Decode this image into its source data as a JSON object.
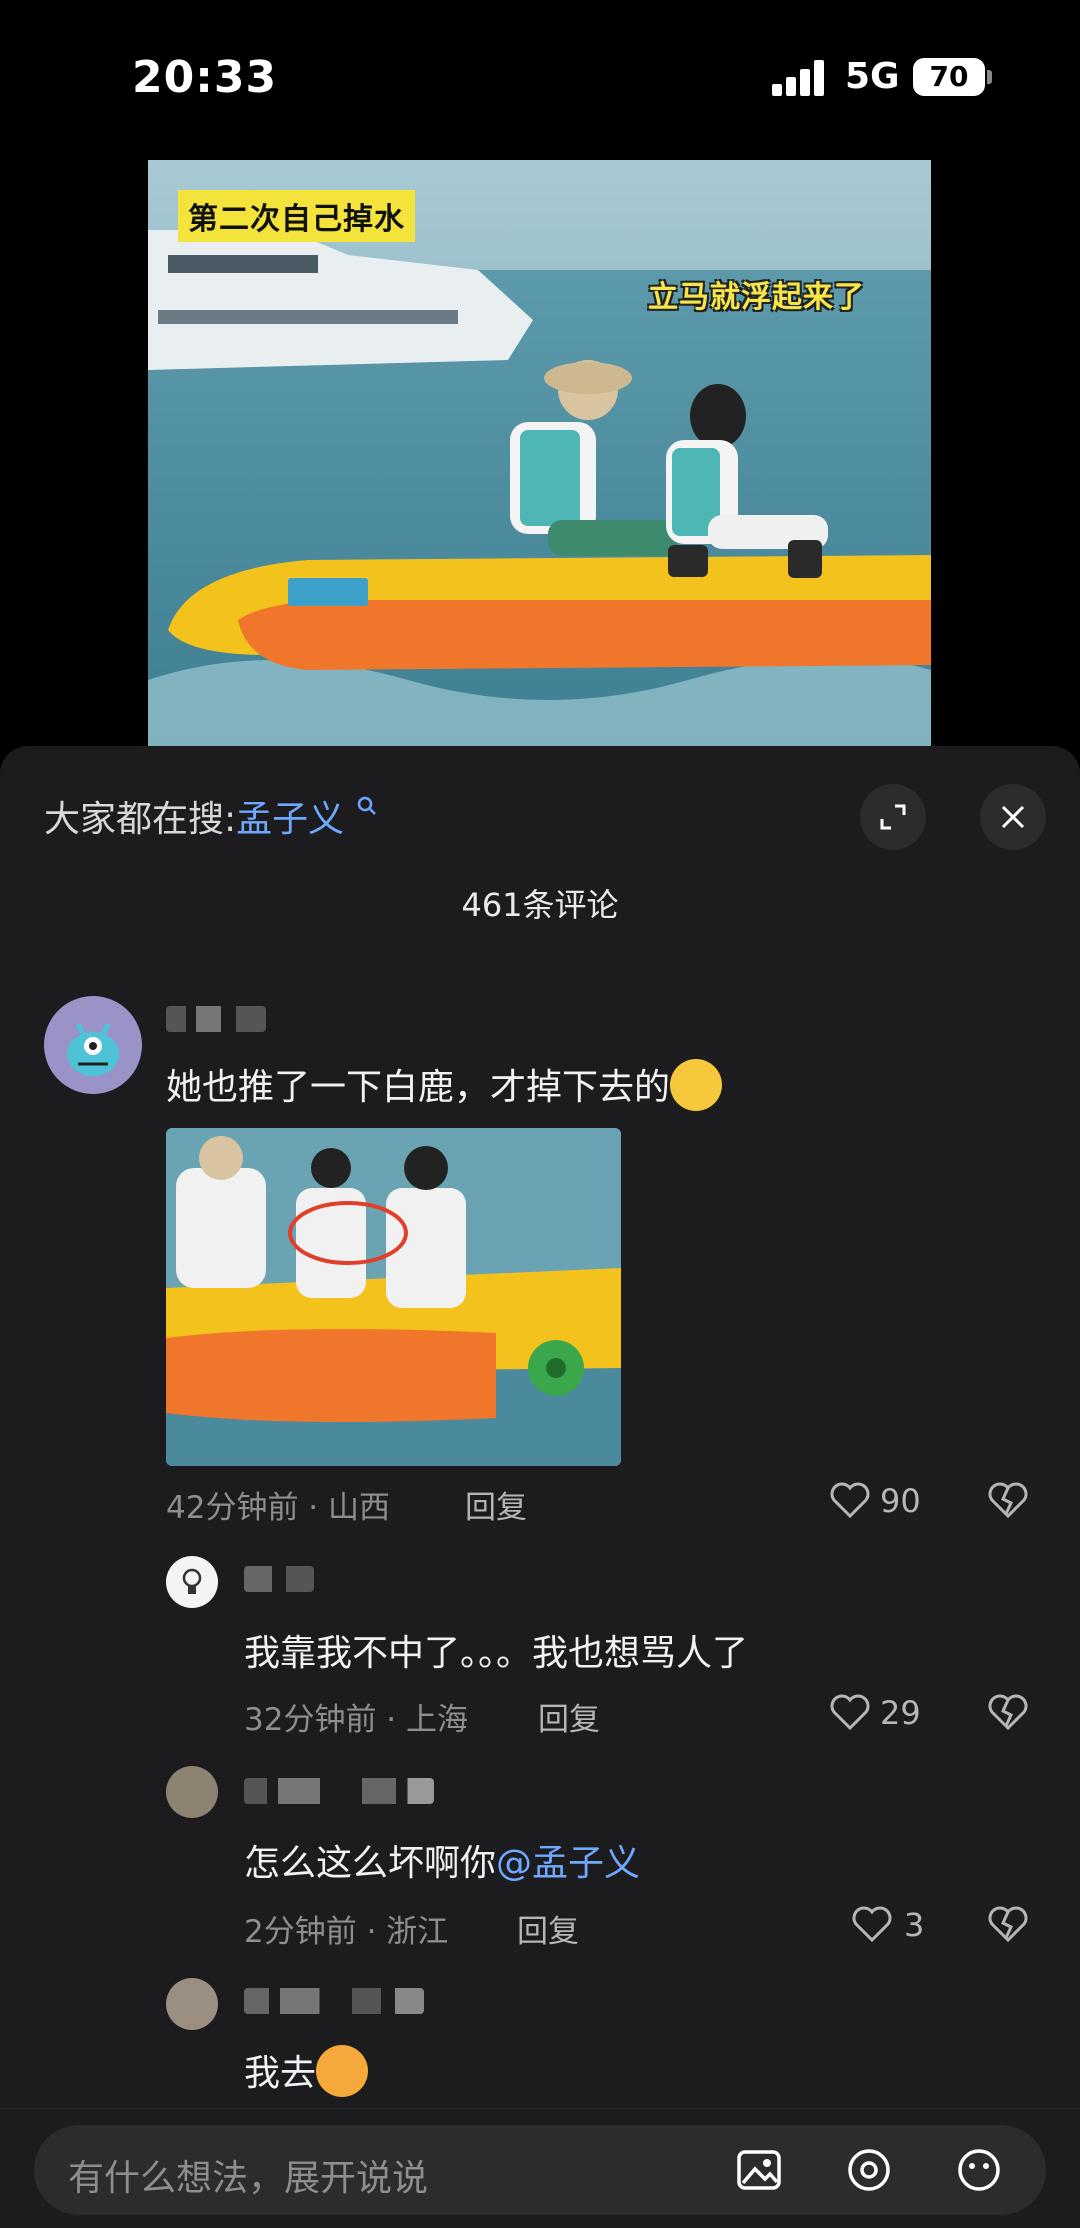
{
  "status_bar": {
    "time": "20:33",
    "network": "5G",
    "battery": "70"
  },
  "video": {
    "caption_top": "第二次自己掉水",
    "caption_right": "立马就浮起来了"
  },
  "panel": {
    "search_prefix": "大家都在搜:",
    "search_keyword": "孟子义",
    "comment_count": "461条评论"
  },
  "comments": [
    {
      "text": "她也推了一下白鹿，才掉下去的",
      "time_location": "42分钟前 · 山西",
      "reply_label": "回复",
      "likes": "90",
      "has_image": true
    }
  ],
  "replies": [
    {
      "text": "我靠我不中了。。。我也想骂人了",
      "time_location": "32分钟前 · 上海",
      "reply_label": "回复",
      "likes": "29"
    },
    {
      "text_prefix": "怎么这么坏啊你",
      "mention": "@孟子义",
      "time_location": "2分钟前 · 浙江",
      "reply_label": "回复",
      "likes": "3"
    },
    {
      "text": "我去"
    }
  ],
  "composer": {
    "placeholder": "有什么想法，展开说说"
  },
  "colors": {
    "sheet_bg": "#1c1c1e",
    "link_blue": "#6fa8ff",
    "meta_gray": "#8d8d92"
  },
  "icons": [
    "expand-icon",
    "close-icon",
    "search-icon",
    "heart-icon",
    "broken-heart-icon",
    "image-icon",
    "at-icon",
    "emoji-icon"
  ]
}
